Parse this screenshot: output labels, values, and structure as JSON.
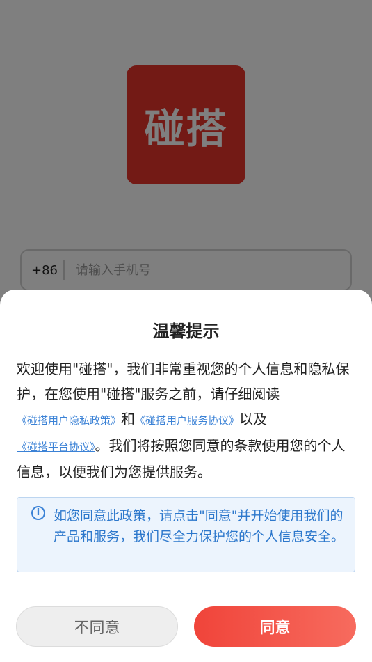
{
  "app": {
    "logo_text": "碰搭",
    "brand_color": "#e7342b"
  },
  "login": {
    "country_code": "+86",
    "phone_placeholder": "请输入手机号"
  },
  "dialog": {
    "title": "温馨提示",
    "intro_part1": "欢迎使用\"碰搭\"，我们非常重视您的个人信息和隐私保护，在您使用\"碰搭\"服务之前，请仔细阅读",
    "link_privacy": "《碰搭用户隐私政策》",
    "text_and": "和",
    "link_service": "《碰搭用户服务协议》",
    "text_as_well_as": "以及",
    "link_platform": "《碰搭平台协议》",
    "intro_part2": "。我们将按照您同意的条款使用您的个人信息，以便我们为您提供服务。",
    "notice_icon": "info-icon",
    "notice_text": "如您同意此政策，请点击\"同意\"并开始使用我们的产品和服务，我们尽全力保护您的个人信息安全。",
    "disagree_label": "不同意",
    "agree_label": "同意",
    "accent_color": "#f0443a",
    "link_color": "#3b82d6"
  }
}
